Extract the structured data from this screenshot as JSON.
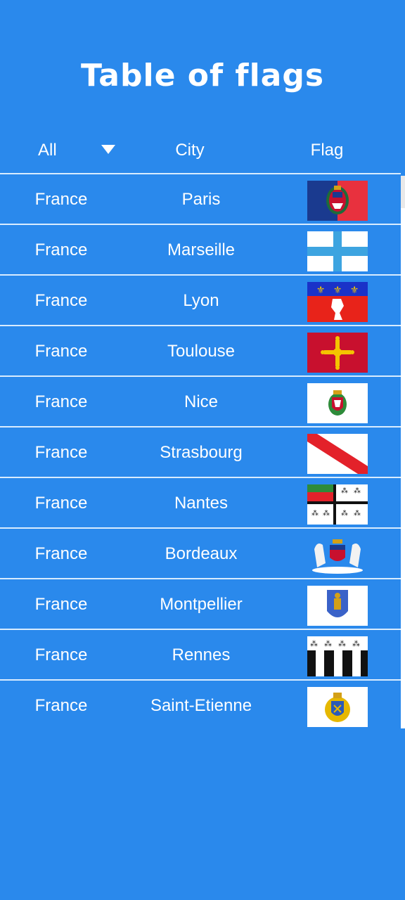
{
  "title": "Table of flags",
  "header": {
    "filter_label": "All",
    "city_label": "City",
    "flag_label": "Flag"
  },
  "rows": [
    {
      "country": "France",
      "city": "Paris",
      "flag_icon": "paris-flag-icon"
    },
    {
      "country": "France",
      "city": "Marseille",
      "flag_icon": "marseille-flag-icon"
    },
    {
      "country": "France",
      "city": "Lyon",
      "flag_icon": "lyon-flag-icon"
    },
    {
      "country": "France",
      "city": "Toulouse",
      "flag_icon": "toulouse-flag-icon"
    },
    {
      "country": "France",
      "city": "Nice",
      "flag_icon": "nice-flag-icon"
    },
    {
      "country": "France",
      "city": "Strasbourg",
      "flag_icon": "strasbourg-flag-icon"
    },
    {
      "country": "France",
      "city": "Nantes",
      "flag_icon": "nantes-flag-icon"
    },
    {
      "country": "France",
      "city": "Bordeaux",
      "flag_icon": "bordeaux-flag-icon"
    },
    {
      "country": "France",
      "city": "Montpellier",
      "flag_icon": "montpellier-flag-icon"
    },
    {
      "country": "France",
      "city": "Rennes",
      "flag_icon": "rennes-flag-icon"
    },
    {
      "country": "France",
      "city": "Saint-Etienne",
      "flag_icon": "saint-etienne-flag-icon"
    }
  ],
  "colors": {
    "background": "#2a89ec",
    "divider": "#d8ecff",
    "text": "#ffffff"
  }
}
